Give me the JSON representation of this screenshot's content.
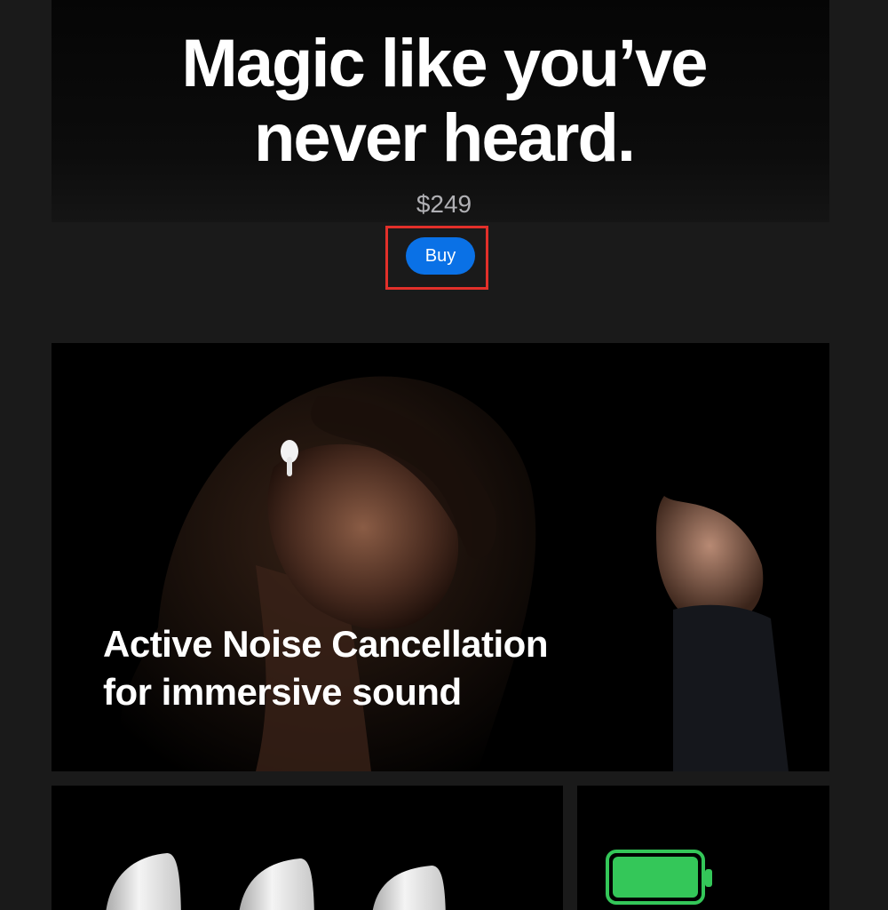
{
  "hero": {
    "headline": "Magic like you’ve\nnever heard.",
    "price": "$249",
    "buy_label": "Buy"
  },
  "anc": {
    "title": "Active Noise Cancellation\nfor immersive sound"
  },
  "colors": {
    "buy_button": "#0a71e6",
    "highlight_box": "#e2302a",
    "battery_fill": "#34c759"
  }
}
